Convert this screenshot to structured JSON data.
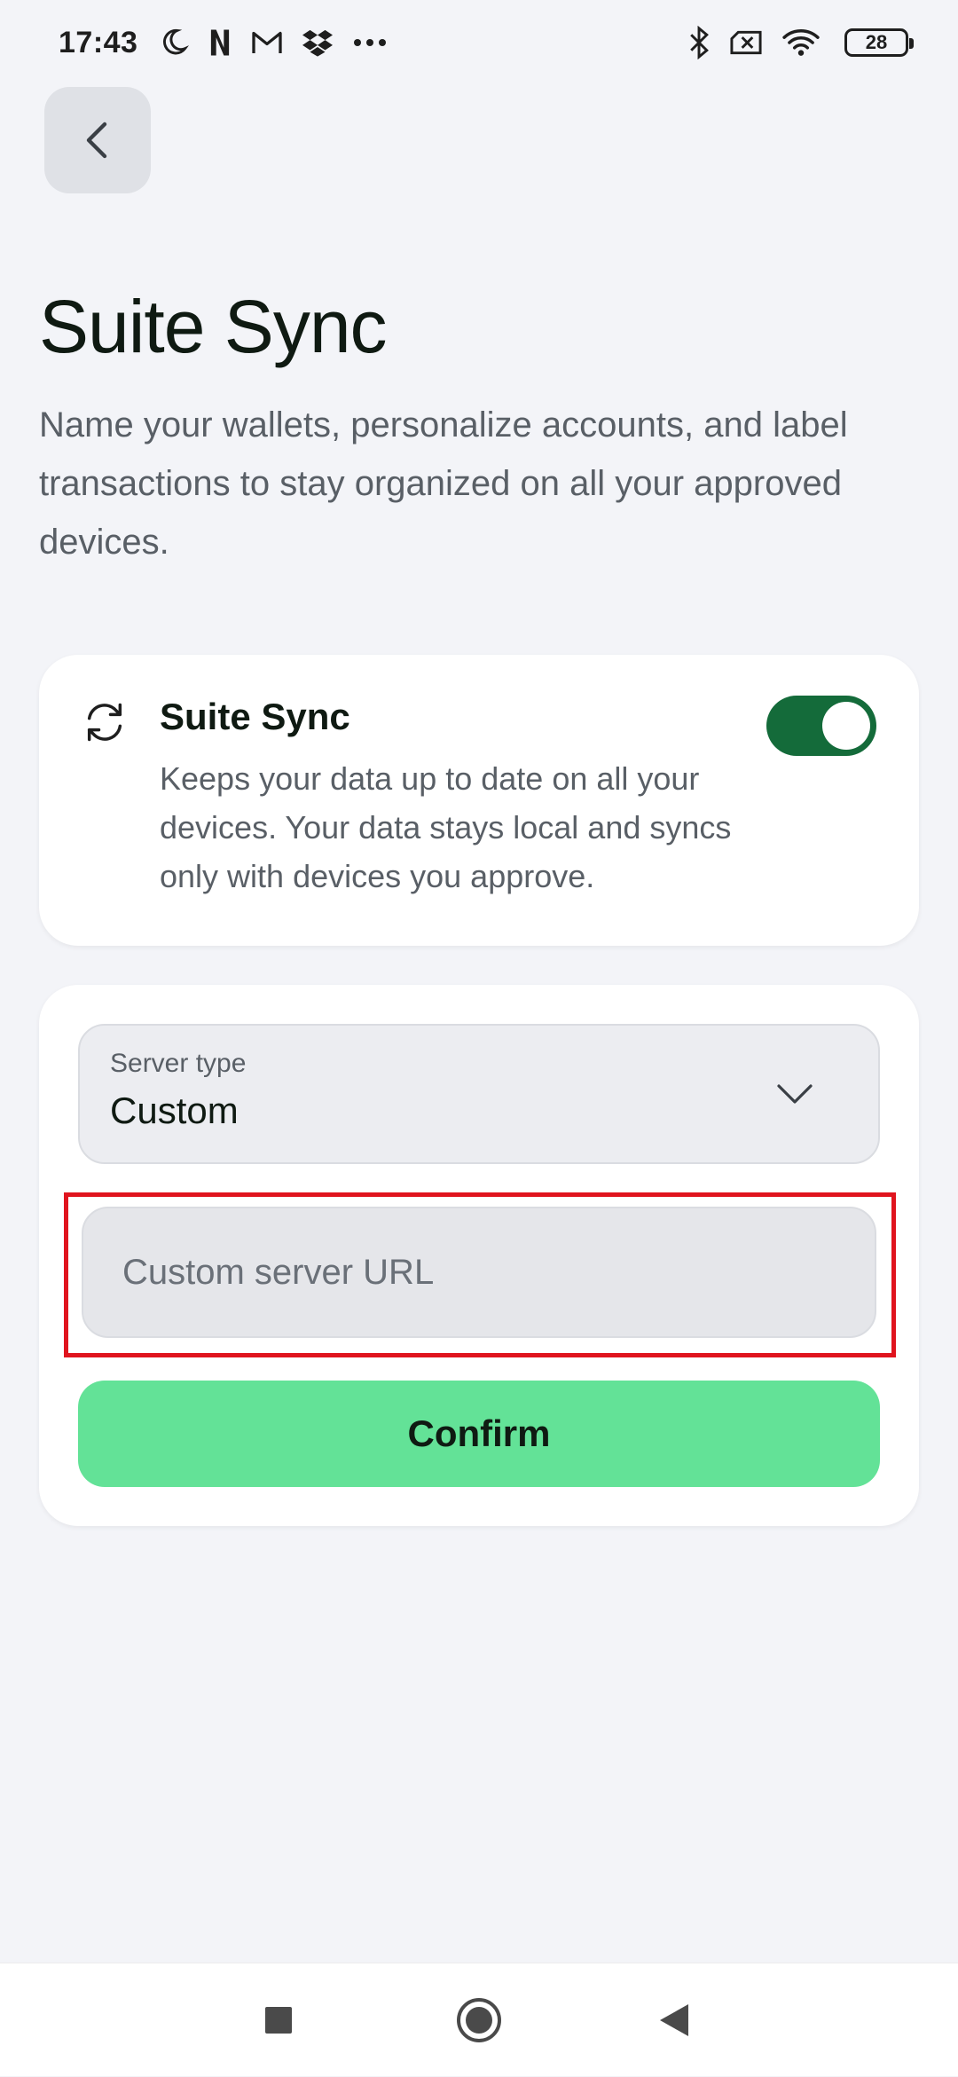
{
  "status_bar": {
    "time": "17:43",
    "left_icons": [
      "moon-icon",
      "n-app-icon",
      "gmail-icon",
      "dropbox-icon",
      "more-dots-icon"
    ],
    "right_icons": [
      "bluetooth-icon",
      "sim-off-icon",
      "wifi-icon"
    ],
    "battery_level": "28"
  },
  "header": {
    "back_icon": "chevron-left-icon"
  },
  "page": {
    "title": "Suite Sync",
    "description": "Name your wallets, personalize accounts, and label transactions to stay organized on all your approved devices."
  },
  "sync_card": {
    "icon": "sync-arrows-icon",
    "title": "Suite Sync",
    "text": "Keeps your data up to date on all your devices. Your data stays local and syncs only with devices you approve.",
    "toggle_on": true
  },
  "server_card": {
    "select_label": "Server type",
    "select_value": "Custom",
    "url_value": "",
    "url_placeholder": "Custom server URL",
    "confirm_label": "Confirm"
  },
  "nav_bar": {
    "icons": [
      "recents-square-icon",
      "home-circle-icon",
      "back-triangle-icon"
    ]
  },
  "colors": {
    "background": "#F3F4F8",
    "card": "#FFFFFF",
    "toggle_on": "#146B3A",
    "confirm": "#63E297",
    "highlight": "#E0141E",
    "text_primary": "#0F1A12",
    "text_secondary": "#595F66"
  }
}
